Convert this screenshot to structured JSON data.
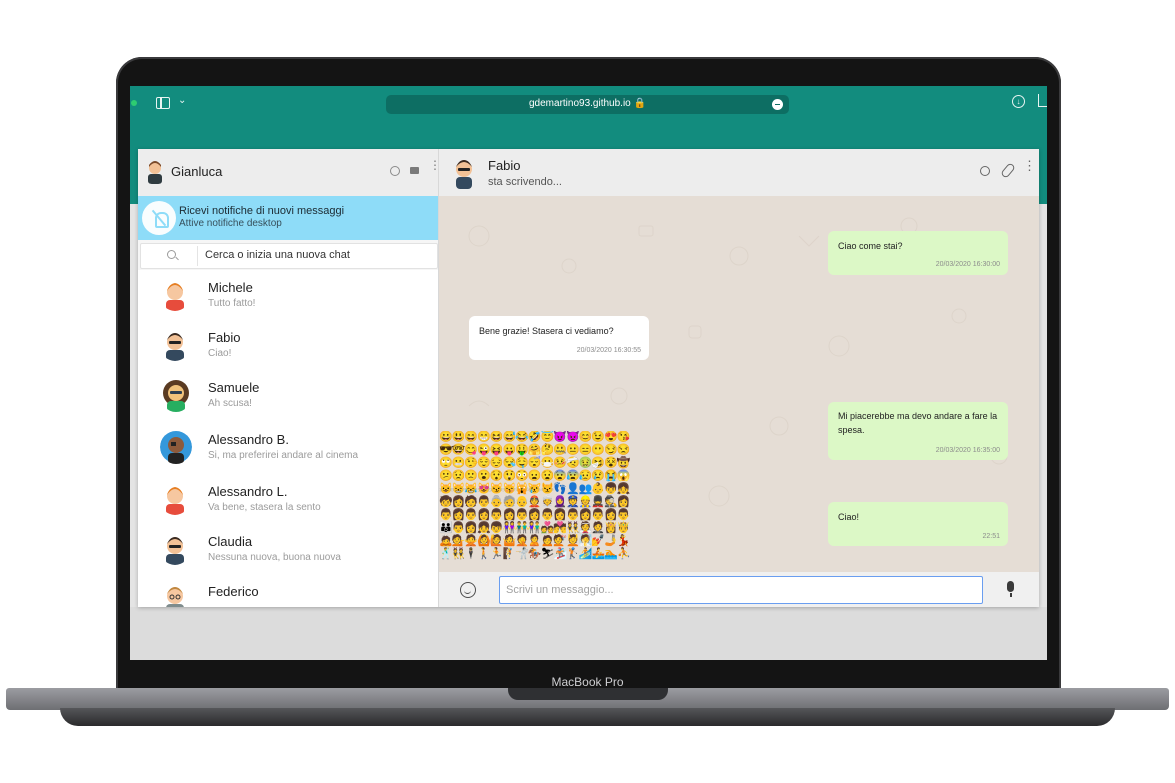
{
  "device": {
    "label": "MacBook Pro"
  },
  "browser": {
    "url": "gdemartino93.github.io",
    "icons": [
      "sidebar-icon",
      "chevron-down-icon",
      "lock-icon",
      "reader-icon",
      "download-icon",
      "share-icon"
    ]
  },
  "user": {
    "name": "Gianluca"
  },
  "notification": {
    "title": "Ricevi notifiche di nuovi messaggi",
    "subtitle": "Attive notifiche desktop"
  },
  "search": {
    "placeholder": "Cerca o inizia una nuova chat"
  },
  "contacts": [
    {
      "name": "Michele",
      "last": "Tutto fatto!"
    },
    {
      "name": "Fabio",
      "last": "Ciao!"
    },
    {
      "name": "Samuele",
      "last": "Ah scusa!"
    },
    {
      "name": "Alessandro B.",
      "last": "Si, ma preferirei andare al cinema"
    },
    {
      "name": "Alessandro L.",
      "last": "Va bene, stasera la sento"
    },
    {
      "name": "Claudia",
      "last": "Nessuna nuova, buona nuova"
    },
    {
      "name": "Federico",
      "last": ""
    }
  ],
  "chat": {
    "partner": "Fabio",
    "status": "sta scrivendo...",
    "messages": [
      {
        "direction": "sent",
        "text": "Ciao come stai?",
        "time": "20/03/2020 16:30:00"
      },
      {
        "direction": "received",
        "text": "Bene grazie! Stasera ci vediamo?",
        "time": "20/03/2020 16:30:55"
      },
      {
        "direction": "sent",
        "text": "Mi piacerebbe ma devo andare a fare la spesa.",
        "time": "20/03/2020 16:35:00"
      },
      {
        "direction": "sent",
        "text": "Ciao!",
        "time": "22:51"
      }
    ]
  },
  "composer": {
    "placeholder": "Scrivi un messaggio..."
  },
  "emojis": [
    "😀😃😄😁😆😅😂🤣😇😈👿😊😉😍😘",
    "😎🤓😋😜😝😛🤑🤗🤔🤐😐😑😶😏😒",
    "🙄😬🤥😌😔😪🤤😴😷🤒🤕🤢🤧😵🤠",
    "😕😟🙁😮😯😲😳😦😧😨😰😥😢😭😱",
    "😺😸😹😻😼😽🙀😿😾👣👤👥👶👦👧",
    "🧒👩🧑👨👵🧓👴👲👳🧕👮👷💂🕵👩",
    "👨👩👨👩👨👩👨👩👨👩👨👩👨👩👨",
    "👪👨👩👧👦👭👬👫💑💏👯👰🤵👸🤴",
    "🙇💁🙅🙆🙋🤷🤦🙎🙍💇💆🧖💅🤳💃",
    "🕺👯🕴🚶🏃🧗🤺🏇⛷🏂🏌🏄🚣🏊⛹"
  ],
  "colors": {
    "brand": "#128c7e",
    "outgoing": "#dcf8c6",
    "incoming": "#ffffff",
    "notification": "#8edcf8",
    "chat_bg": "#e5ddd5"
  }
}
